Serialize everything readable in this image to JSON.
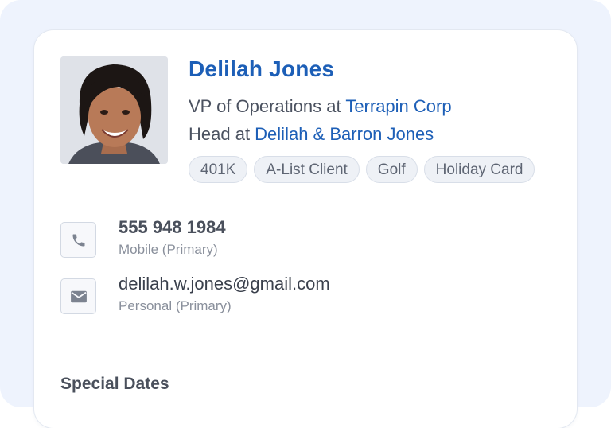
{
  "contact": {
    "name": "Delilah Jones",
    "roles": [
      {
        "title": "VP of Operations at ",
        "org": "Terrapin Corp"
      },
      {
        "title": "Head at ",
        "org": "Delilah & Barron Jones"
      }
    ],
    "tags": [
      "401K",
      "A-List Client",
      "Golf",
      "Holiday Card"
    ],
    "phone": {
      "value": "555 948 1984",
      "label": "Mobile (Primary)",
      "icon": "phone-icon"
    },
    "email": {
      "value": "delilah.w.jones@gmail.com",
      "label": "Personal (Primary)",
      "icon": "envelope-icon"
    }
  },
  "sections": {
    "special_dates_title": "Special Dates"
  },
  "colors": {
    "accent": "#1d5fb7",
    "background": "#eef3fd"
  }
}
